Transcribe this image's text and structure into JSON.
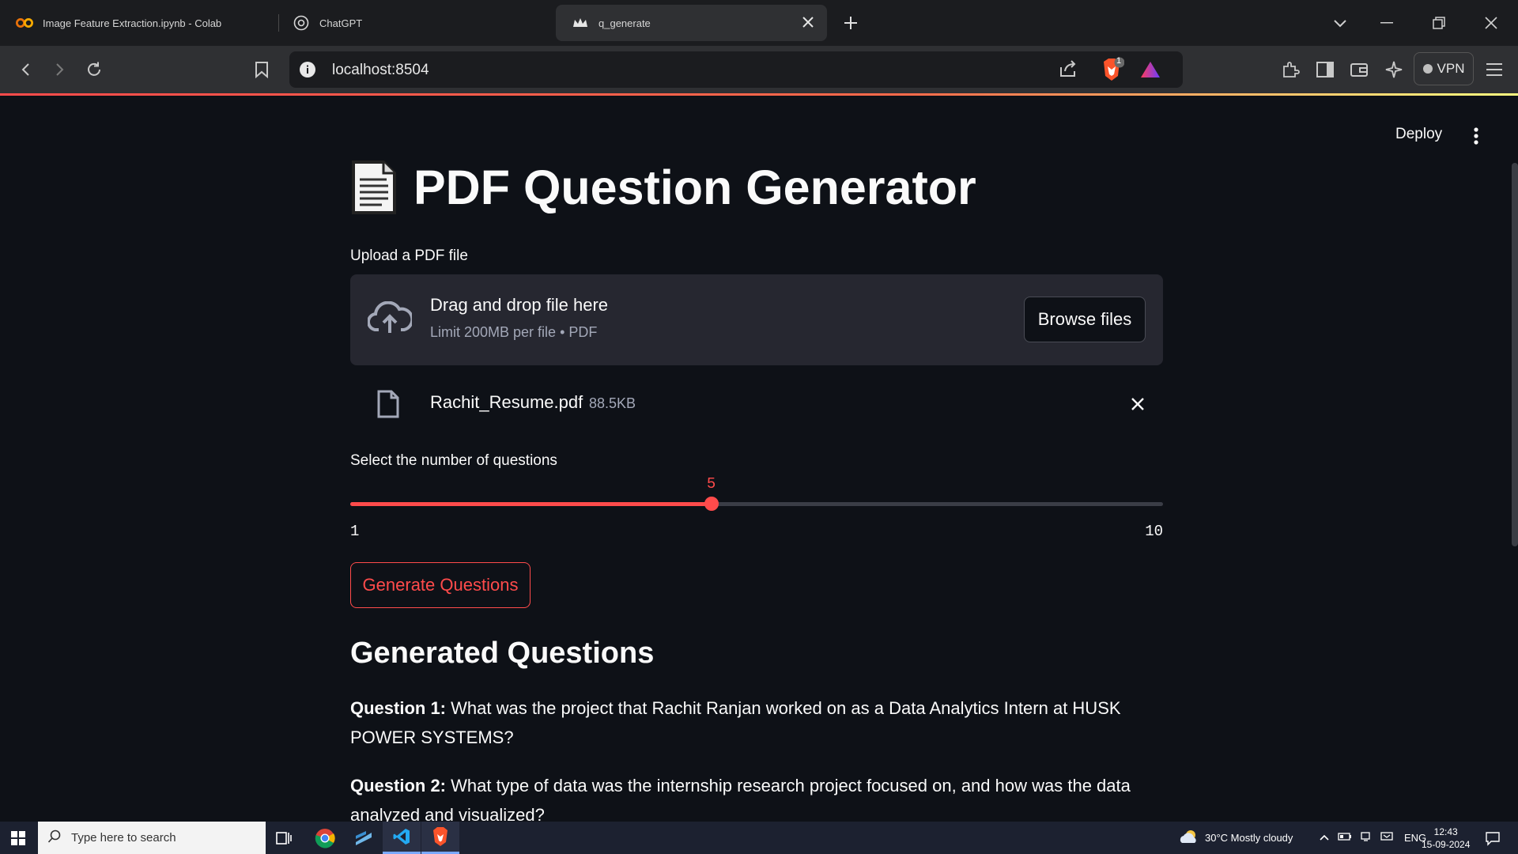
{
  "browser": {
    "tabs": [
      {
        "title": "Image Feature Extraction.ipynb - Colab"
      },
      {
        "title": "ChatGPT"
      },
      {
        "title": "q_generate"
      }
    ],
    "url": "localhost:8504",
    "vpn_label": "VPN",
    "brave_badge": "1"
  },
  "app": {
    "deploy_label": "Deploy",
    "title": "PDF Question Generator",
    "upload_label": "Upload a PDF file",
    "dropzone_title": "Drag and drop file here",
    "dropzone_sub": "Limit 200MB per file • PDF",
    "browse_label": "Browse files",
    "file_name": "Rachit_Resume.pdf",
    "file_size": "88.5KB",
    "slider_label": "Select the number of questions",
    "slider": {
      "value": 5,
      "min": 1,
      "max": 10
    },
    "slider_value_text": "5",
    "slider_min_text": "1",
    "slider_max_text": "10",
    "generate_label": "Generate Questions",
    "generated_heading": "Generated Questions",
    "questions": [
      {
        "label": "Question 1:",
        "text": " What was the project that Rachit Ranjan worked on as a Data Analytics Intern at HUSK POWER SYSTEMS?"
      },
      {
        "label": "Question 2:",
        "text": " What type of data was the internship research project focused on, and how was the data analyzed and visualized?"
      }
    ]
  },
  "taskbar": {
    "search_placeholder": "Type here to search",
    "weather": "30°C  Mostly cloudy",
    "lang": "ENG",
    "time": "12:43",
    "date": "15-09-2024"
  },
  "colors": {
    "accent": "#ff4b4b",
    "bg": "#0e1117",
    "panel": "#262730"
  }
}
